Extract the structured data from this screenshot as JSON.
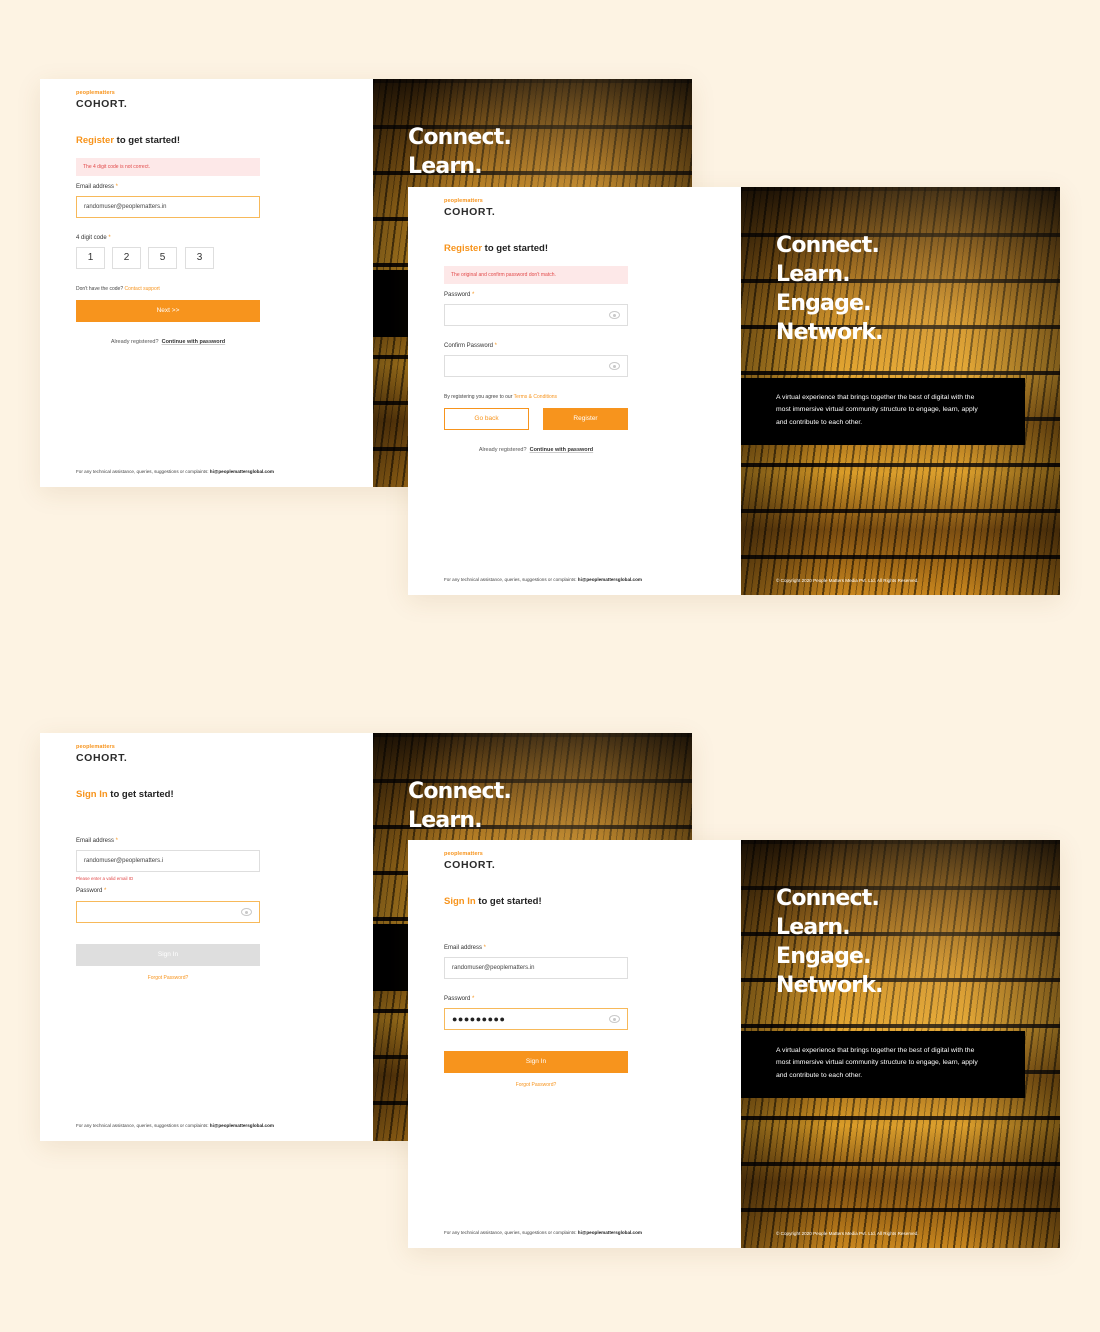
{
  "brand": {
    "small": "peoplematters",
    "big": "COHORT."
  },
  "tagline": {
    "line1": "Connect.",
    "line2": "Learn.",
    "line3": "Engage.",
    "line4": "Network."
  },
  "description": "A virtual experience that brings together the best of digital with the most immersive virtual community structure to engage, learn, apply and contribute to each other.",
  "copyright": "© Copyright 2020 People Matters Media Pvt. Ltd.  All Rights Reserved.",
  "footer": {
    "prefix": "For any technical assistance, queries, suggestions or complaints: ",
    "email": "hi@peoplemattersglobal.com"
  },
  "screen1": {
    "heading_accent": "Register",
    "heading_rest": " to get started!",
    "alert": "The 4 digit code is not correct.",
    "email_label": "Email address",
    "email_value": "randomuser@peoplematters.in",
    "code_label": "4 digit code",
    "digits": [
      "1",
      "2",
      "5",
      "3"
    ],
    "no_code_text": "Don't have the code? ",
    "contact_support": "Contact support",
    "next_button": "Next >>",
    "already_text": "Already registered?",
    "continue_link": "Continue with password"
  },
  "screen2": {
    "heading_accent": "Register",
    "heading_rest": " to get started!",
    "alert": "The original and confirm password don't match.",
    "password_label": "Password",
    "confirm_label": "Confirm Password",
    "terms_text": "By registering you agree to our ",
    "terms_link": "Terms & Conditions",
    "go_back_button": "Go back",
    "register_button": "Register",
    "already_text": "Already registered?",
    "continue_link": "Continue with password"
  },
  "screen3": {
    "heading_accent": "Sign In",
    "heading_rest": " to get started!",
    "email_label": "Email address",
    "email_value": "randomuser@peoplematters.i",
    "email_error": "Please enter a valid email ID",
    "password_label": "Password",
    "signin_button": "Sign In",
    "forgot_link": "Forgot Password?"
  },
  "screen4": {
    "heading_accent": "Sign In",
    "heading_rest": " to get started!",
    "email_label": "Email address",
    "email_value": "randomuser@peoplematters.in",
    "password_label": "Password",
    "password_mask": "●●●●●●●●●",
    "signin_button": "Sign In",
    "forgot_link": "Forgot Password?"
  },
  "required_mark": " *",
  "colors": {
    "accent": "#f7941d",
    "background": "#fdf3e3",
    "error": "#e24a4a"
  },
  "icons": {
    "password_toggle": "eye-icon"
  }
}
